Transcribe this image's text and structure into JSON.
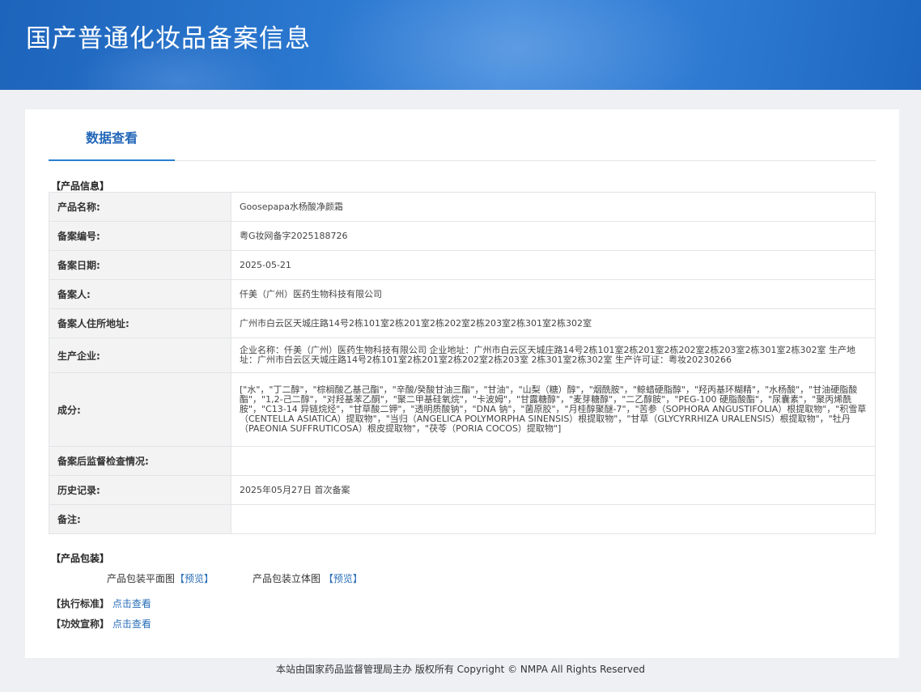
{
  "header": {
    "title": "国产普通化妆品备案信息"
  },
  "tabs": [
    {
      "label": "数据查看"
    }
  ],
  "product_info": {
    "section_label": "【产品信息】",
    "rows": [
      {
        "key": "产品名称:",
        "value": "Goosepapa水杨酸净颜霜"
      },
      {
        "key": "备案编号:",
        "value": "粤G妆网备字2025188726"
      },
      {
        "key": "备案日期:",
        "value": "2025-05-21"
      },
      {
        "key": "备案人:",
        "value": "仟美（广州）医药生物科技有限公司"
      },
      {
        "key": "备案人住所地址:",
        "value": "广州市白云区天城庄路14号2栋101室2栋201室2栋202室2栋203室2栋301室2栋302室"
      },
      {
        "key": "生产企业:",
        "value": "企业名称：仟美（广州）医药生物科技有限公司 企业地址：广州市白云区天城庄路14号2栋101室2栋201室2栋202室2栋203室2栋301室2栋302室 生产地址：广州市白云区天城庄路14号2栋101室2栋201室2栋202室2栋203室 2栋301室2栋302室 生产许可证：粤妆20230266"
      },
      {
        "key": "成分:",
        "value": "[\"水\"，\"丁二醇\"，\"棕榈酸乙基己酯\"，\"辛酸/癸酸甘油三酯\"，\"甘油\"，\"山梨（糖）醇\"，\"烟酰胺\"，\"鲸蜡硬脂醇\"，\"羟丙基环糊精\"，\"水杨酸\"，\"甘油硬脂酸酯\"，\"1,2-己二醇\"，\"对羟基苯乙酮\"，\"聚二甲基硅氧烷\"，\"卡波姆\"，\"甘露糖醇\"，\"麦芽糖醇\"，\"二乙醇胺\"，\"PEG-100 硬脂酸酯\"，\"尿囊素\"，\"聚丙烯酰胺\"，\"C13-14 异链烷烃\"，\"甘草酸二钾\"，\"透明质酸钠\"，\"DNA 钠\"，\"菌原胶\"，\"月桂醇聚醚-7\"，\"苦参（SOPHORA ANGUSTIFOLIA）根提取物\"，\"积雪草（CENTELLA ASIATICA）提取物\"，\"当归（ANGELICA POLYMORPHA SINENSIS）根提取物\"，\"甘草（GLYCYRRHIZA URALENSIS）根提取物\"，\"牡丹（PAEONIA SUFFRUTICOSA）根皮提取物\"，\"茯苓（PORIA COCOS）提取物\"]"
      },
      {
        "key": "备案后监督检查情况:",
        "value": ""
      },
      {
        "key": "历史记录:",
        "value": "2025年05月27日 首次备案"
      },
      {
        "key": "备注:",
        "value": ""
      }
    ]
  },
  "packaging": {
    "section_label": "【产品包装】",
    "flat_label": "产品包装平面图",
    "flat_link": "【预览】",
    "3d_label": "产品包装立体图",
    "3d_link": "【预览】"
  },
  "standard": {
    "label": "【执行标准】",
    "link": "点击查看"
  },
  "efficacy": {
    "label": "【功效宣称】",
    "link": "点击查看"
  },
  "footer": {
    "text": "本站由国家药品监督管理局主办 版权所有 Copyright © NMPA All Rights Reserved"
  },
  "colors": {
    "banner": "#2b78d0",
    "accent": "#2a7fd0",
    "link": "#2a6fb8"
  }
}
